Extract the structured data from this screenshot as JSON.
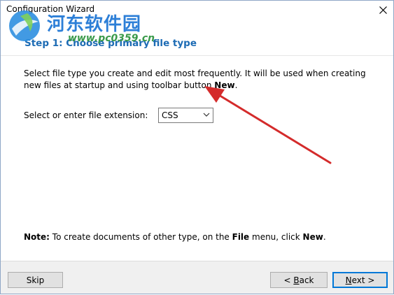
{
  "window": {
    "title": "Configuration Wizard",
    "close_icon": "close-icon"
  },
  "watermark": {
    "text": "河东软件园",
    "url": "www.pc0359.cn"
  },
  "step": {
    "title": "Step 1: Choose primary file type"
  },
  "description": {
    "text_a": "Select file type you create and edit most frequently. It will be used when creating new files at startup and using toolbar button ",
    "text_bold": "New",
    "text_end": "."
  },
  "extension_field": {
    "label": "Select or enter file extension:",
    "value": "CSS"
  },
  "note": {
    "label": "Note:",
    "text_a": " To create documents of other type, on the ",
    "file_word": "File",
    "text_b": " menu, click ",
    "new_word": "New",
    "text_end": "."
  },
  "buttons": {
    "skip": "Skip",
    "back_prefix": "< ",
    "back_accel": "B",
    "back_rest": "ack",
    "next_accel": "N",
    "next_rest": "ext >"
  },
  "colors": {
    "step_title": "#1c6bb4",
    "arrow": "#d42b2b",
    "next_focus": "#0078d7"
  }
}
